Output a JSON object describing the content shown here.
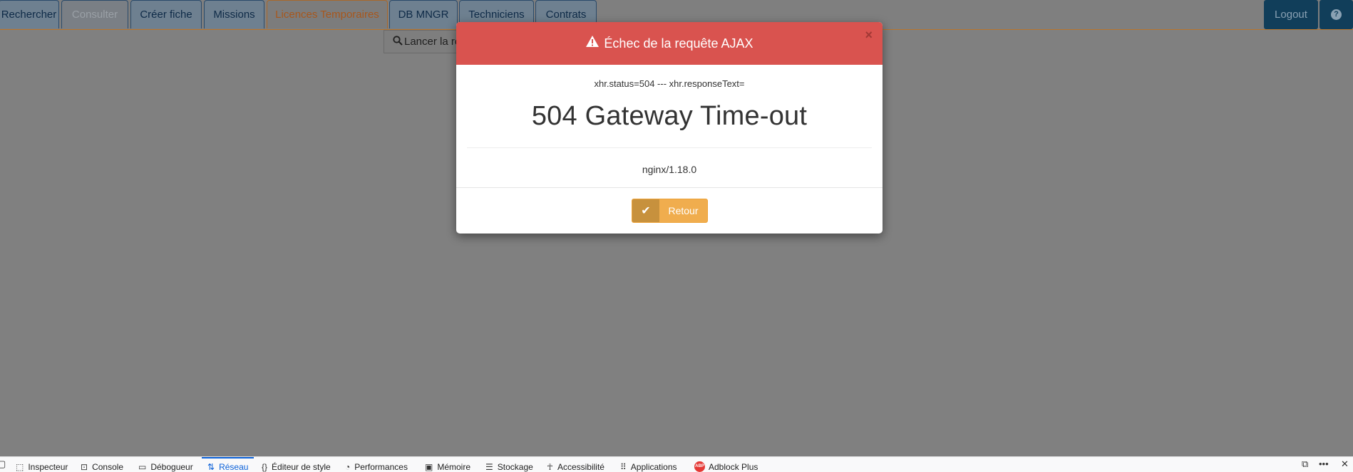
{
  "nav": {
    "tabs": [
      {
        "label": "Rechercher",
        "state": "normal"
      },
      {
        "label": "Consulter",
        "state": "disabled"
      },
      {
        "label": "Créer fiche",
        "state": "normal"
      },
      {
        "label": "Missions",
        "state": "normal"
      },
      {
        "label": "Licences Temporaires",
        "state": "active"
      },
      {
        "label": "DB MNGR",
        "state": "normal"
      },
      {
        "label": "Techniciens",
        "state": "normal"
      },
      {
        "label": "Contrats",
        "state": "normal"
      }
    ],
    "logout_label": "Logout",
    "help_icon": "question-circle-icon"
  },
  "search": {
    "label": "Lancer la re"
  },
  "modal": {
    "title": "Échec de la requête AJAX",
    "title_icon": "warning-icon",
    "close_label": "×",
    "status_line": "xhr.status=504 --- xhr.responseText=",
    "error_title": "504 Gateway Time-out",
    "server": "nginx/1.18.0",
    "button_label": "Retour",
    "button_icon": "check-icon",
    "header_color": "#d9534f",
    "button_color": "#f0ad4e"
  },
  "devtools": {
    "tabs": [
      {
        "label": "Inspecteur",
        "icon": "inspector-icon"
      },
      {
        "label": "Console",
        "icon": "console-icon"
      },
      {
        "label": "Débogueur",
        "icon": "debugger-icon"
      },
      {
        "label": "Réseau",
        "icon": "network-icon",
        "active": true
      },
      {
        "label": "Éditeur de style",
        "icon": "style-editor-icon"
      },
      {
        "label": "Performances",
        "icon": "performance-icon"
      },
      {
        "label": "Mémoire",
        "icon": "memory-icon"
      },
      {
        "label": "Stockage",
        "icon": "storage-icon"
      },
      {
        "label": "Accessibilité",
        "icon": "accessibility-icon"
      },
      {
        "label": "Applications",
        "icon": "applications-icon"
      },
      {
        "label": "Adblock Plus",
        "icon": "abp-icon"
      }
    ],
    "abp_badge": "ABP"
  }
}
